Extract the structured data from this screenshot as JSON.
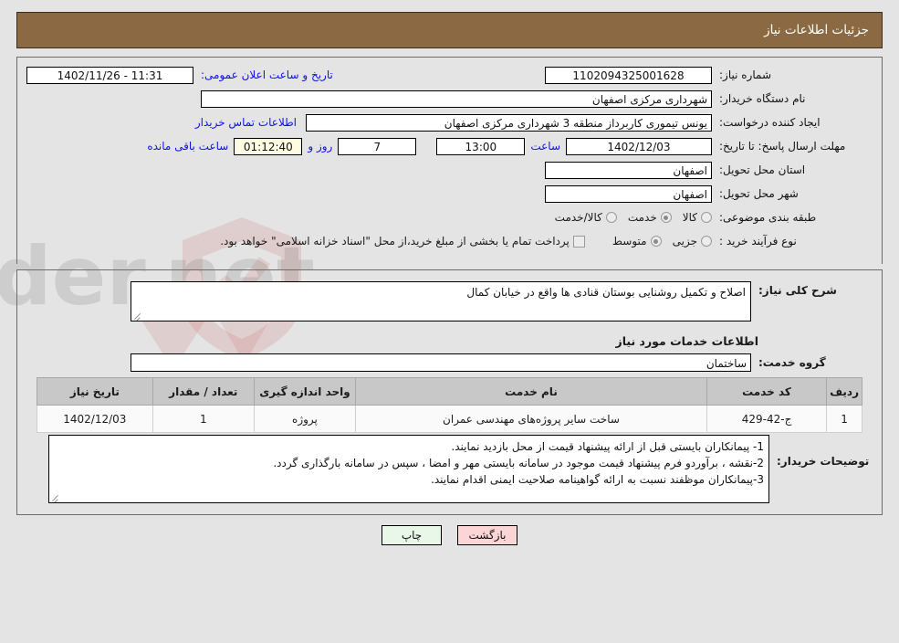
{
  "header": {
    "title": "جزئیات اطلاعات نیاز"
  },
  "colors": {
    "header_bar": "#8b6a43",
    "link": "#1010ee",
    "countdown_bg": "#fdfce2",
    "print_button_bg": "#e8f7e8",
    "back_button_bg": "#fcd6d6"
  },
  "info": {
    "need_number_label": "شماره نیاز:",
    "need_number_value": "1102094325001628",
    "announce_label": "تاریخ و ساعت اعلان عمومی:",
    "announce_value": "11:31 - 1402/11/26",
    "buyer_org_label": "نام دستگاه خریدار:",
    "buyer_org_value": "شهرداری مرکزی اصفهان",
    "creator_label": "ایجاد کننده درخواست:",
    "creator_value": "یونس تیموری کاربرداز منطقه 3 شهرداری مرکزی اصفهان",
    "contact_link": "اطلاعات تماس خریدار",
    "deadline_label": "مهلت ارسال پاسخ: تا تاریخ:",
    "deadline_date": "1402/12/03",
    "hour_label": "ساعت",
    "deadline_time": "13:00",
    "days_remaining": "7",
    "days_and_label": "روز و",
    "countdown": "01:12:40",
    "remaining_label": "ساعت باقی مانده",
    "province_label": "استان محل تحویل:",
    "province_value": "اصفهان",
    "city_label": "شهر محل تحویل:",
    "city_value": "اصفهان",
    "category_label": "طبقه بندی موضوعی:",
    "category_options": [
      {
        "label": "کالا",
        "selected": false
      },
      {
        "label": "خدمت",
        "selected": true
      },
      {
        "label": "کالا/خدمت",
        "selected": false
      }
    ],
    "process_label": "نوع فرآیند خرید :",
    "process_options": [
      {
        "label": "جزیی",
        "selected": false
      },
      {
        "label": "متوسط",
        "selected": true
      }
    ],
    "treasury_checkbox_label": "پرداخت تمام یا بخشی از مبلغ خرید،از محل \"اسناد خزانه اسلامی\" خواهد بود.",
    "treasury_checked": false
  },
  "description": {
    "label": "شرح کلی نیاز:",
    "value": "اصلاح و تکمیل روشنایی بوستان قنادی ها واقع در خیابان کمال"
  },
  "services": {
    "section_title": "اطلاعات خدمات مورد نیاز",
    "group_label": "گروه خدمت:",
    "group_value": "ساختمان",
    "table": {
      "columns": [
        "ردیف",
        "کد خدمت",
        "نام خدمت",
        "واحد اندازه گیری",
        "تعداد / مقدار",
        "تاریخ نیاز"
      ],
      "rows": [
        {
          "radif": "1",
          "code": "ج-42-429",
          "name": "ساخت سایر پروژه‌های مهندسی عمران",
          "unit": "پروژه",
          "qty": "1",
          "date": "1402/12/03"
        }
      ]
    }
  },
  "notes": {
    "label": "توضیحات خریدار:",
    "lines": [
      "1- پیمانکاران بایستی قبل از ارائه پیشنهاد قیمت از محل بازدید نمایند.",
      "2-نقشه ، برآوردو فرم پیشنهاد قیمت موجود در سامانه بایستی مهر و امضا ، سپس در سامانه بارگذاری گردد.",
      "3-پیمانکاران موظفند نسبت به ارائه گواهینامه صلاحیت ایمنی اقدام نمایند."
    ]
  },
  "footer": {
    "print_label": "چاپ",
    "back_label": "بازگشت"
  },
  "watermark": {
    "text": "AriaTender.net"
  }
}
